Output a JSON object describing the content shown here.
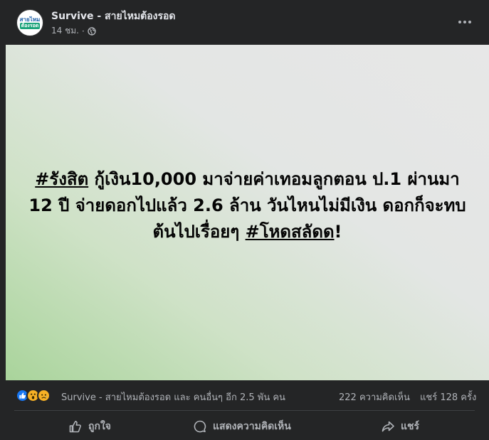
{
  "post": {
    "page_name": "Survive - สายไหมต้องรอด",
    "time": "14 ชม.",
    "separator": "·",
    "avatar": {
      "line1": "สายไหม",
      "line2": "ต้องรอด"
    }
  },
  "headline": {
    "tag1": "#รังสิต",
    "body": " กู้เงิน10,000 มาจ่ายค่าเทอมลูกตอน ป.1 ผ่านมา 12 ปี จ่ายดอกไปแล้ว 2.6 ล้าน วันไหนไม่มีเงิน ดอกก็จะทบต้นไปเรื่อยๆ ",
    "tag2": "#โหดสลัดด",
    "ending": "!"
  },
  "reactions": {
    "icons": [
      "like-icon",
      "wow-icon",
      "sad-icon"
    ],
    "summary": "Survive - สายไหมต้องรอด และ คนอื่นๆ อีก 2.5 พัน คน",
    "comments": "222 ความคิดเห็น",
    "shares": "แชร์ 128 ครั้ง"
  },
  "actions": {
    "like": "ถูกใจ",
    "comment": "แสดงความคิดเห็น",
    "share": "แชร์"
  },
  "colors": {
    "background": "#242526",
    "accent_like": "#1877f2",
    "reaction_yellow": "#f7b125",
    "secondary_text": "#b0b3b8"
  }
}
